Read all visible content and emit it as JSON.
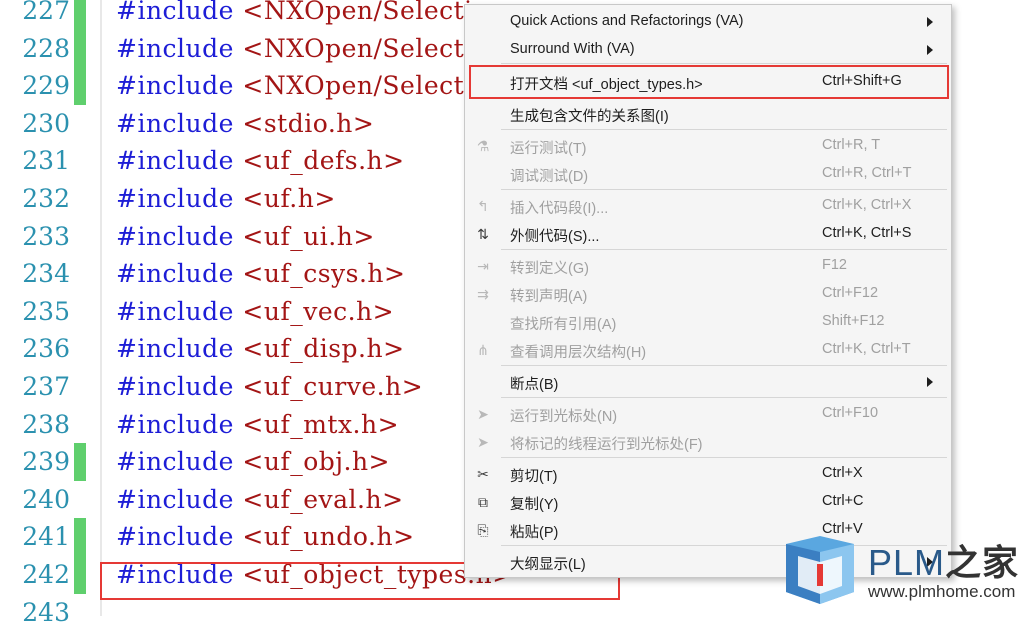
{
  "editor": {
    "lines": [
      {
        "num": "227",
        "kw": "#include",
        "rest": " <NXOpen/Selectic"
      },
      {
        "num": "228",
        "kw": "#include",
        "rest": " <NXOpen/Selectic"
      },
      {
        "num": "229",
        "kw": "#include",
        "rest": " <NXOpen/Selectic"
      },
      {
        "num": "230",
        "kw": "#include",
        "rest": " <stdio.h>"
      },
      {
        "num": "231",
        "kw": "#include",
        "rest": " <uf_defs.h>"
      },
      {
        "num": "232",
        "kw": "#include",
        "rest": " <uf.h>"
      },
      {
        "num": "233",
        "kw": "#include",
        "rest": " <uf_ui.h>"
      },
      {
        "num": "234",
        "kw": "#include",
        "rest": " <uf_csys.h>"
      },
      {
        "num": "235",
        "kw": "#include",
        "rest": " <uf_vec.h>"
      },
      {
        "num": "236",
        "kw": "#include",
        "rest": " <uf_disp.h>"
      },
      {
        "num": "237",
        "kw": "#include",
        "rest": " <uf_curve.h>"
      },
      {
        "num": "238",
        "kw": "#include",
        "rest": " <uf_mtx.h>"
      },
      {
        "num": "239",
        "kw": "#include",
        "rest": " <uf_obj.h>"
      },
      {
        "num": "240",
        "kw": "#include",
        "rest": " <uf_eval.h>"
      },
      {
        "num": "241",
        "kw": "#include",
        "rest": " <uf_undo.h>"
      },
      {
        "num": "242",
        "kw": "#include",
        "rest": " <uf_object_types.h>"
      },
      {
        "num": "243",
        "kw": "",
        "rest": ""
      }
    ],
    "changed_lines": [
      "227",
      "228",
      "229",
      "239",
      "241",
      "242"
    ],
    "colors": {
      "keyword": "#1d1dd6",
      "include_path": "#a31515",
      "line_number": "#2b91af",
      "change_bar": "#5fcf6d",
      "highlight_border": "#e53935"
    }
  },
  "context_menu": {
    "items": [
      {
        "label": "Quick Actions and Refactorings (VA)",
        "shortcut": "",
        "submenu": true,
        "disabled": false,
        "icon": ""
      },
      {
        "label": "Surround With (VA)",
        "shortcut": "",
        "submenu": true,
        "disabled": false,
        "icon": ""
      },
      {
        "label": "打开文档 <uf_object_types.h>",
        "shortcut": "Ctrl+Shift+G",
        "submenu": false,
        "disabled": false,
        "icon": ""
      },
      {
        "label": "生成包含文件的关系图(I)",
        "shortcut": "",
        "submenu": false,
        "disabled": false,
        "icon": ""
      },
      {
        "label": "运行测试(T)",
        "shortcut": "Ctrl+R, T",
        "submenu": false,
        "disabled": true,
        "icon": "flask-icon"
      },
      {
        "label": "调试测试(D)",
        "shortcut": "Ctrl+R, Ctrl+T",
        "submenu": false,
        "disabled": true,
        "icon": ""
      },
      {
        "label": "插入代码段(I)...",
        "shortcut": "Ctrl+K, Ctrl+X",
        "submenu": false,
        "disabled": true,
        "icon": "insert-snippet-icon"
      },
      {
        "label": "外侧代码(S)...",
        "shortcut": "Ctrl+K, Ctrl+S",
        "submenu": false,
        "disabled": false,
        "icon": "surround-code-icon"
      },
      {
        "label": "转到定义(G)",
        "shortcut": "F12",
        "submenu": false,
        "disabled": true,
        "icon": "go-to-definition-icon"
      },
      {
        "label": "转到声明(A)",
        "shortcut": "Ctrl+F12",
        "submenu": false,
        "disabled": true,
        "icon": "go-to-declaration-icon"
      },
      {
        "label": "查找所有引用(A)",
        "shortcut": "Shift+F12",
        "submenu": false,
        "disabled": true,
        "icon": ""
      },
      {
        "label": "查看调用层次结构(H)",
        "shortcut": "Ctrl+K, Ctrl+T",
        "submenu": false,
        "disabled": true,
        "icon": "call-hierarchy-icon"
      },
      {
        "label": "断点(B)",
        "shortcut": "",
        "submenu": true,
        "disabled": false,
        "icon": ""
      },
      {
        "label": "运行到光标处(N)",
        "shortcut": "Ctrl+F10",
        "submenu": false,
        "disabled": true,
        "icon": "cursor-arrow-icon"
      },
      {
        "label": "将标记的线程运行到光标处(F)",
        "shortcut": "",
        "submenu": false,
        "disabled": true,
        "icon": "cursor-arrow-icon"
      },
      {
        "label": "剪切(T)",
        "shortcut": "Ctrl+X",
        "submenu": false,
        "disabled": false,
        "icon": "scissors-icon"
      },
      {
        "label": "复制(Y)",
        "shortcut": "Ctrl+C",
        "submenu": false,
        "disabled": false,
        "icon": "copy-icon"
      },
      {
        "label": "粘贴(P)",
        "shortcut": "Ctrl+V",
        "submenu": false,
        "disabled": false,
        "icon": "paste-icon"
      },
      {
        "label": "大纲显示(L)",
        "shortcut": "",
        "submenu": true,
        "disabled": false,
        "icon": ""
      }
    ]
  },
  "watermark": {
    "brand": "PLM",
    "brand_cn": "之家",
    "url": "www.plmhome.com"
  }
}
